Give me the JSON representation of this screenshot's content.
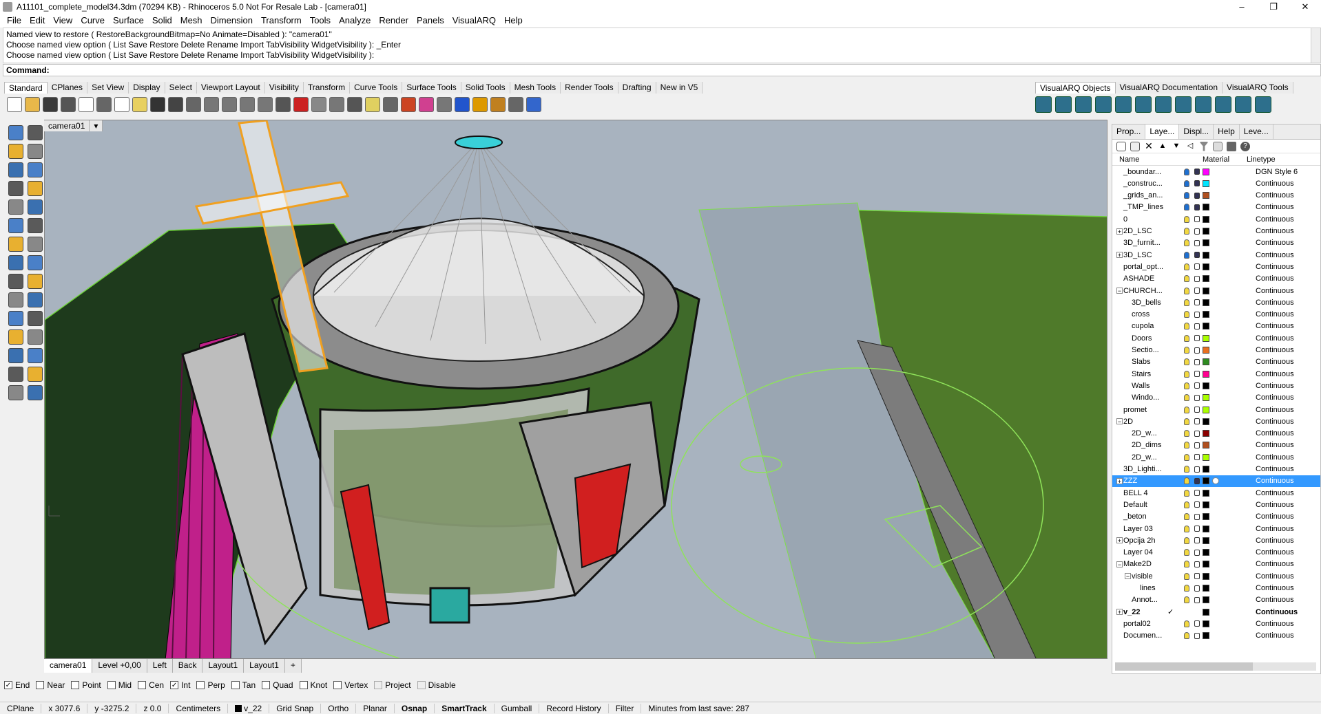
{
  "window": {
    "title": "A11101_complete_model34.3dm (70294 KB) - Rhinoceros 5.0 Not For Resale Lab - [camera01]",
    "controls": [
      "–",
      "❐",
      "✕"
    ]
  },
  "menu": [
    "File",
    "Edit",
    "View",
    "Curve",
    "Surface",
    "Solid",
    "Mesh",
    "Dimension",
    "Transform",
    "Tools",
    "Analyze",
    "Render",
    "Panels",
    "VisualARQ",
    "Help"
  ],
  "command_history": [
    "Named view to restore ( RestoreBackgroundBitmap=No  Animate=Disabled ): \"camera01\"",
    "Choose named view option ( List  Save  Restore  Delete  Rename  Import  TabVisibility  WidgetVisibility ): _Enter",
    "Choose named view option ( List  Save  Restore  Delete  Rename  Import  TabVisibility  WidgetVisibility ):"
  ],
  "command_prompt": "Command:",
  "toolbar_tabs": [
    "Standard",
    "CPlanes",
    "Set View",
    "Display",
    "Select",
    "Viewport Layout",
    "Visibility",
    "Transform",
    "Curve Tools",
    "Surface Tools",
    "Solid Tools",
    "Mesh Tools",
    "Render Tools",
    "Drafting",
    "New in V5"
  ],
  "visualarq_tabs": [
    "VisualARQ Objects",
    "VisualARQ Documentation",
    "VisualARQ Tools"
  ],
  "viewport": {
    "name": "camera01",
    "dropdown": "▾",
    "tabs": [
      "camera01",
      "Level +0,00",
      "Left",
      "Back",
      "Layout1",
      "Layout1",
      "+"
    ]
  },
  "osnap": [
    {
      "label": "End",
      "checked": true
    },
    {
      "label": "Near",
      "checked": false
    },
    {
      "label": "Point",
      "checked": false
    },
    {
      "label": "Mid",
      "checked": false
    },
    {
      "label": "Cen",
      "checked": false
    },
    {
      "label": "Int",
      "checked": true
    },
    {
      "label": "Perp",
      "checked": false
    },
    {
      "label": "Tan",
      "checked": false
    },
    {
      "label": "Quad",
      "checked": false
    },
    {
      "label": "Knot",
      "checked": false
    },
    {
      "label": "Vertex",
      "checked": false
    },
    {
      "label": "Project",
      "checked": false,
      "disabled": true
    },
    {
      "label": "Disable",
      "checked": false,
      "disabled": true
    }
  ],
  "status": {
    "cplane": "CPlane",
    "x": "x 3077.6",
    "y": "y -3275.2",
    "z": "z 0.0",
    "units": "Centimeters",
    "layer": "v_22",
    "buttons": [
      {
        "label": "Grid Snap",
        "bold": false
      },
      {
        "label": "Ortho",
        "bold": false
      },
      {
        "label": "Planar",
        "bold": false
      },
      {
        "label": "Osnap",
        "bold": true
      },
      {
        "label": "SmartTrack",
        "bold": true
      },
      {
        "label": "Gumball",
        "bold": false
      },
      {
        "label": "Record History",
        "bold": false
      },
      {
        "label": "Filter",
        "bold": false
      }
    ],
    "save_info": "Minutes from last save: 287"
  },
  "panel": {
    "tabs": [
      "Prop...",
      "Laye...",
      "Displ...",
      "Help",
      "Leve..."
    ],
    "active_tab": 1,
    "columns": {
      "name": "Name",
      "material": "Material",
      "linetype": "Linetype"
    },
    "layers": [
      {
        "name": "_boundar...",
        "indent": 0,
        "exp": "",
        "color": "#ff00ff",
        "bulb": "blue",
        "lock": "closed",
        "linetype": "DGN Style 6"
      },
      {
        "name": "_construc...",
        "indent": 0,
        "exp": "",
        "color": "#00e5ff",
        "bulb": "blue",
        "lock": "closed",
        "linetype": "Continuous"
      },
      {
        "name": "_grids_an...",
        "indent": 0,
        "exp": "",
        "color": "#b05020",
        "bulb": "blue",
        "lock": "closed",
        "linetype": "Continuous"
      },
      {
        "name": "_TMP_lines",
        "indent": 0,
        "exp": "",
        "color": "#000000",
        "bulb": "blue",
        "lock": "closed",
        "linetype": "Continuous"
      },
      {
        "name": "0",
        "indent": 0,
        "exp": "",
        "color": "#000000",
        "bulb": "yellow",
        "lock": "open",
        "linetype": "Continuous"
      },
      {
        "name": "2D_LSC",
        "indent": 0,
        "exp": "+",
        "color": "#000000",
        "bulb": "yellow",
        "lock": "open",
        "linetype": "Continuous"
      },
      {
        "name": "3D_furnit...",
        "indent": 0,
        "exp": "",
        "color": "#000000",
        "bulb": "yellow",
        "lock": "open",
        "linetype": "Continuous"
      },
      {
        "name": "3D_LSC",
        "indent": 0,
        "exp": "+",
        "color": "#000000",
        "bulb": "blue",
        "lock": "closed",
        "linetype": "Continuous"
      },
      {
        "name": "portal_opt...",
        "indent": 0,
        "exp": "",
        "color": "#000000",
        "bulb": "yellow",
        "lock": "open",
        "linetype": "Continuous"
      },
      {
        "name": "ASHADE",
        "indent": 0,
        "exp": "",
        "color": "#000000",
        "bulb": "yellow",
        "lock": "open",
        "linetype": "Continuous"
      },
      {
        "name": "CHURCH...",
        "indent": 0,
        "exp": "−",
        "color": "#000000",
        "bulb": "yellow",
        "lock": "open",
        "linetype": "Continuous"
      },
      {
        "name": "3D_bells",
        "indent": 1,
        "exp": "",
        "color": "#000000",
        "bulb": "yellow",
        "lock": "open",
        "linetype": "Continuous"
      },
      {
        "name": "cross",
        "indent": 1,
        "exp": "",
        "color": "#000000",
        "bulb": "yellow",
        "lock": "open",
        "linetype": "Continuous"
      },
      {
        "name": "cupola",
        "indent": 1,
        "exp": "",
        "color": "#000000",
        "bulb": "yellow",
        "lock": "open",
        "linetype": "Continuous"
      },
      {
        "name": "Doors",
        "indent": 1,
        "exp": "",
        "color": "#aaff00",
        "bulb": "yellow",
        "lock": "open",
        "linetype": "Continuous"
      },
      {
        "name": "Sectio...",
        "indent": 1,
        "exp": "",
        "color": "#e87020",
        "bulb": "yellow",
        "lock": "open",
        "linetype": "Continuous"
      },
      {
        "name": "Slabs",
        "indent": 1,
        "exp": "",
        "color": "#2e8b20",
        "bulb": "yellow",
        "lock": "open",
        "linetype": "Continuous"
      },
      {
        "name": "Stairs",
        "indent": 1,
        "exp": "",
        "color": "#ff0090",
        "bulb": "yellow",
        "lock": "open",
        "linetype": "Continuous"
      },
      {
        "name": "Walls",
        "indent": 1,
        "exp": "",
        "color": "#000000",
        "bulb": "yellow",
        "lock": "open",
        "linetype": "Continuous"
      },
      {
        "name": "Windo...",
        "indent": 1,
        "exp": "",
        "color": "#aaff00",
        "bulb": "yellow",
        "lock": "open",
        "linetype": "Continuous"
      },
      {
        "name": "promet",
        "indent": 0,
        "exp": "",
        "color": "#aaff00",
        "bulb": "yellow",
        "lock": "open",
        "linetype": "Continuous"
      },
      {
        "name": "2D",
        "indent": 0,
        "exp": "−",
        "color": "#000000",
        "bulb": "yellow",
        "lock": "open",
        "linetype": "Continuous"
      },
      {
        "name": "2D_w...",
        "indent": 1,
        "exp": "",
        "color": "#8b0000",
        "bulb": "yellow",
        "lock": "open",
        "linetype": "Continuous"
      },
      {
        "name": "2D_dims",
        "indent": 1,
        "exp": "",
        "color": "#b05020",
        "bulb": "yellow",
        "lock": "open",
        "linetype": "Continuous"
      },
      {
        "name": "2D_w...",
        "indent": 1,
        "exp": "",
        "color": "#aaff00",
        "bulb": "yellow",
        "lock": "open",
        "linetype": "Continuous"
      },
      {
        "name": "3D_Lighti...",
        "indent": 0,
        "exp": "",
        "color": "#000000",
        "bulb": "yellow",
        "lock": "open",
        "linetype": "Continuous"
      },
      {
        "name": "ZZZ",
        "indent": 0,
        "exp": "+",
        "color": "#000000",
        "bulb": "yellow",
        "lock": "closed",
        "linetype": "Continuous",
        "selected": true
      },
      {
        "name": "BELL 4",
        "indent": 0,
        "exp": "",
        "color": "#000000",
        "bulb": "yellow",
        "lock": "open",
        "linetype": "Continuous"
      },
      {
        "name": "Default",
        "indent": 0,
        "exp": "",
        "color": "#000000",
        "bulb": "yellow",
        "lock": "open",
        "linetype": "Continuous"
      },
      {
        "name": "_beton",
        "indent": 0,
        "exp": "",
        "color": "#000000",
        "bulb": "yellow",
        "lock": "open",
        "linetype": "Continuous"
      },
      {
        "name": "Layer 03",
        "indent": 0,
        "exp": "",
        "color": "#000000",
        "bulb": "yellow",
        "lock": "open",
        "linetype": "Continuous"
      },
      {
        "name": "Opcija 2h",
        "indent": 0,
        "exp": "+",
        "color": "#000000",
        "bulb": "yellow",
        "lock": "open",
        "linetype": "Continuous"
      },
      {
        "name": "Layer 04",
        "indent": 0,
        "exp": "",
        "color": "#000000",
        "bulb": "yellow",
        "lock": "open",
        "linetype": "Continuous"
      },
      {
        "name": "Make2D",
        "indent": 0,
        "exp": "−",
        "color": "#000000",
        "bulb": "yellow",
        "lock": "open",
        "linetype": "Continuous"
      },
      {
        "name": "visible",
        "indent": 1,
        "exp": "−",
        "color": "#000000",
        "bulb": "yellow",
        "lock": "open",
        "linetype": "Continuous"
      },
      {
        "name": "lines",
        "indent": 2,
        "exp": "",
        "color": "#000000",
        "bulb": "yellow",
        "lock": "open",
        "linetype": "Continuous"
      },
      {
        "name": "Annot...",
        "indent": 1,
        "exp": "",
        "color": "#000000",
        "bulb": "yellow",
        "lock": "open",
        "linetype": "Continuous"
      },
      {
        "name": "v_22",
        "indent": 0,
        "exp": "+",
        "color": "#000000",
        "bulb": "none",
        "lock": "none",
        "linetype": "Continuous",
        "current": true,
        "bold": true
      },
      {
        "name": "portal02",
        "indent": 0,
        "exp": "",
        "color": "#000000",
        "bulb": "yellow",
        "lock": "open",
        "linetype": "Continuous"
      },
      {
        "name": "Documen...",
        "indent": 0,
        "exp": "",
        "color": "#000000",
        "bulb": "yellow",
        "lock": "open",
        "linetype": "Continuous"
      }
    ]
  },
  "colors": {
    "selection": "#3399ff",
    "viewport_bg": "#a8b3bf",
    "terrain_green": "#4f7a2a",
    "dark_green": "#1e3a1c",
    "stairs_pink": "#c0208a"
  }
}
